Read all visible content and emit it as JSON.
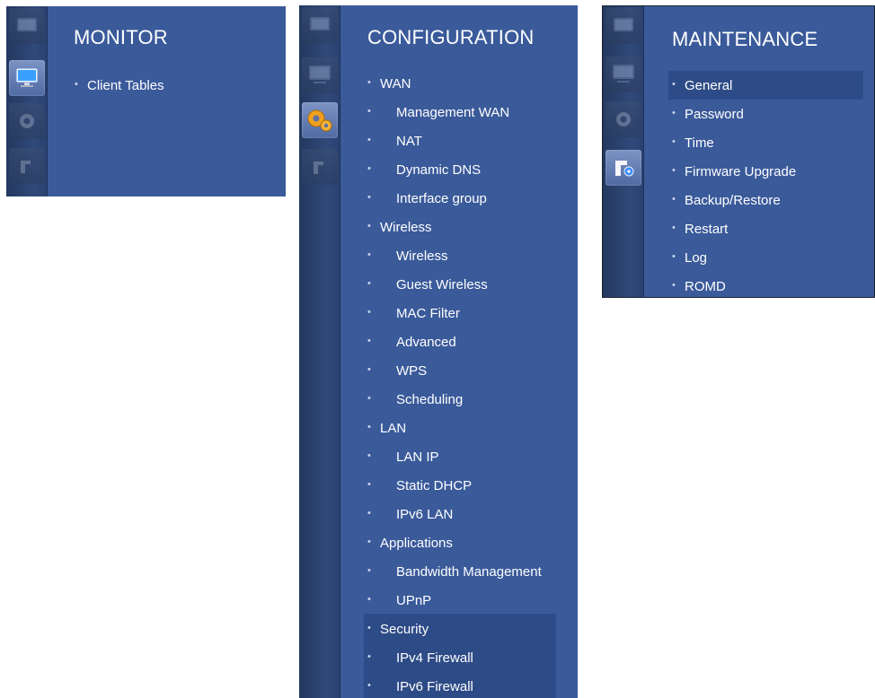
{
  "monitor": {
    "title": "MONITOR",
    "items": [
      {
        "label": "Client Tables"
      }
    ]
  },
  "configuration": {
    "title": "CONFIGURATION",
    "items": [
      {
        "label": "WAN",
        "level": 0
      },
      {
        "label": "Management WAN",
        "level": 1
      },
      {
        "label": "NAT",
        "level": 1
      },
      {
        "label": "Dynamic DNS",
        "level": 1
      },
      {
        "label": "Interface group",
        "level": 1
      },
      {
        "label": "Wireless",
        "level": 0
      },
      {
        "label": "Wireless",
        "level": 1
      },
      {
        "label": "Guest Wireless",
        "level": 1
      },
      {
        "label": "MAC Filter",
        "level": 1
      },
      {
        "label": "Advanced",
        "level": 1
      },
      {
        "label": "WPS",
        "level": 1
      },
      {
        "label": "Scheduling",
        "level": 1
      },
      {
        "label": "LAN",
        "level": 0
      },
      {
        "label": "LAN IP",
        "level": 1
      },
      {
        "label": "Static DHCP",
        "level": 1
      },
      {
        "label": "IPv6 LAN",
        "level": 1
      },
      {
        "label": "Applications",
        "level": 0
      },
      {
        "label": "Bandwidth Management",
        "level": 1
      },
      {
        "label": "UPnP",
        "level": 1
      },
      {
        "label": "Security",
        "level": 0
      },
      {
        "label": "IPv4 Firewall",
        "level": 1
      },
      {
        "label": "IPv6 Firewall",
        "level": 1
      }
    ]
  },
  "maintenance": {
    "title": "MAINTENANCE",
    "items": [
      {
        "label": "General"
      },
      {
        "label": "Password"
      },
      {
        "label": "Time"
      },
      {
        "label": "Firmware Upgrade"
      },
      {
        "label": "Backup/Restore"
      },
      {
        "label": "Restart"
      },
      {
        "label": "Log"
      },
      {
        "label": "ROMD"
      }
    ]
  },
  "sidebar_icons": [
    "monitor-icon",
    "gear-icon",
    "maintenance-icon",
    "status-icon"
  ],
  "colors": {
    "panel_bg": "#3a5a9a",
    "sidebar_bg": "#2a4170",
    "highlight_bg": "#2d4b86",
    "text": "#ffffff"
  }
}
